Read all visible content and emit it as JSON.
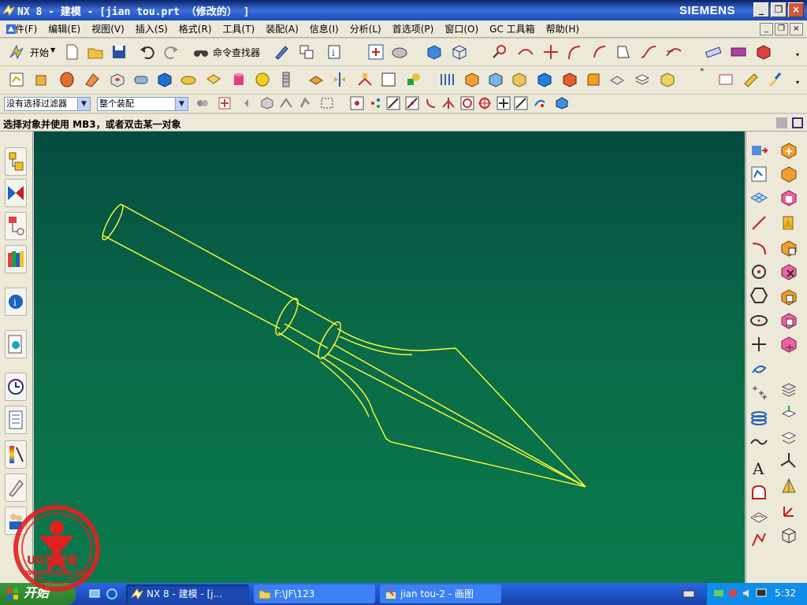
{
  "window": {
    "title": "NX 8 - 建模 - [jian tou.prt （修改的） ]",
    "brand": "SIEMENS",
    "controls": [
      "_",
      "❐",
      "×"
    ]
  },
  "menubar": {
    "items": [
      "文件(F)",
      "编辑(E)",
      "视图(V)",
      "插入(S)",
      "格式(R)",
      "工具(T)",
      "装配(A)",
      "信息(I)",
      "分析(L)",
      "首选项(P)",
      "窗口(O)",
      "GC 工具箱",
      "帮助(H)"
    ]
  },
  "toolbar": {
    "start_label": "开始",
    "command_finder_label": "命令查找器"
  },
  "selection": {
    "filter_value": "没有选择过滤器",
    "scope_value": "整个装配"
  },
  "status": {
    "cue_text": "选择对象并使用 MB3，或者双击某一对象"
  },
  "taskbar": {
    "start_label": "开始",
    "tasks": [
      {
        "label": "NX 8 - 建模 - [j...",
        "active": true
      },
      {
        "label": "F:\\JF\\123",
        "active": false
      },
      {
        "label": "jian tou-2 - 画图",
        "active": false
      }
    ],
    "clock": "5:32"
  },
  "watermark": {
    "text": "UG爱好者",
    "url": "WWW.UGSNX.COM"
  },
  "colors": {
    "viewport_top": "#044c40",
    "viewport_bottom": "#0a7a4c",
    "wireframe": "#ffff33",
    "titlebar": "#1c4bb8"
  }
}
